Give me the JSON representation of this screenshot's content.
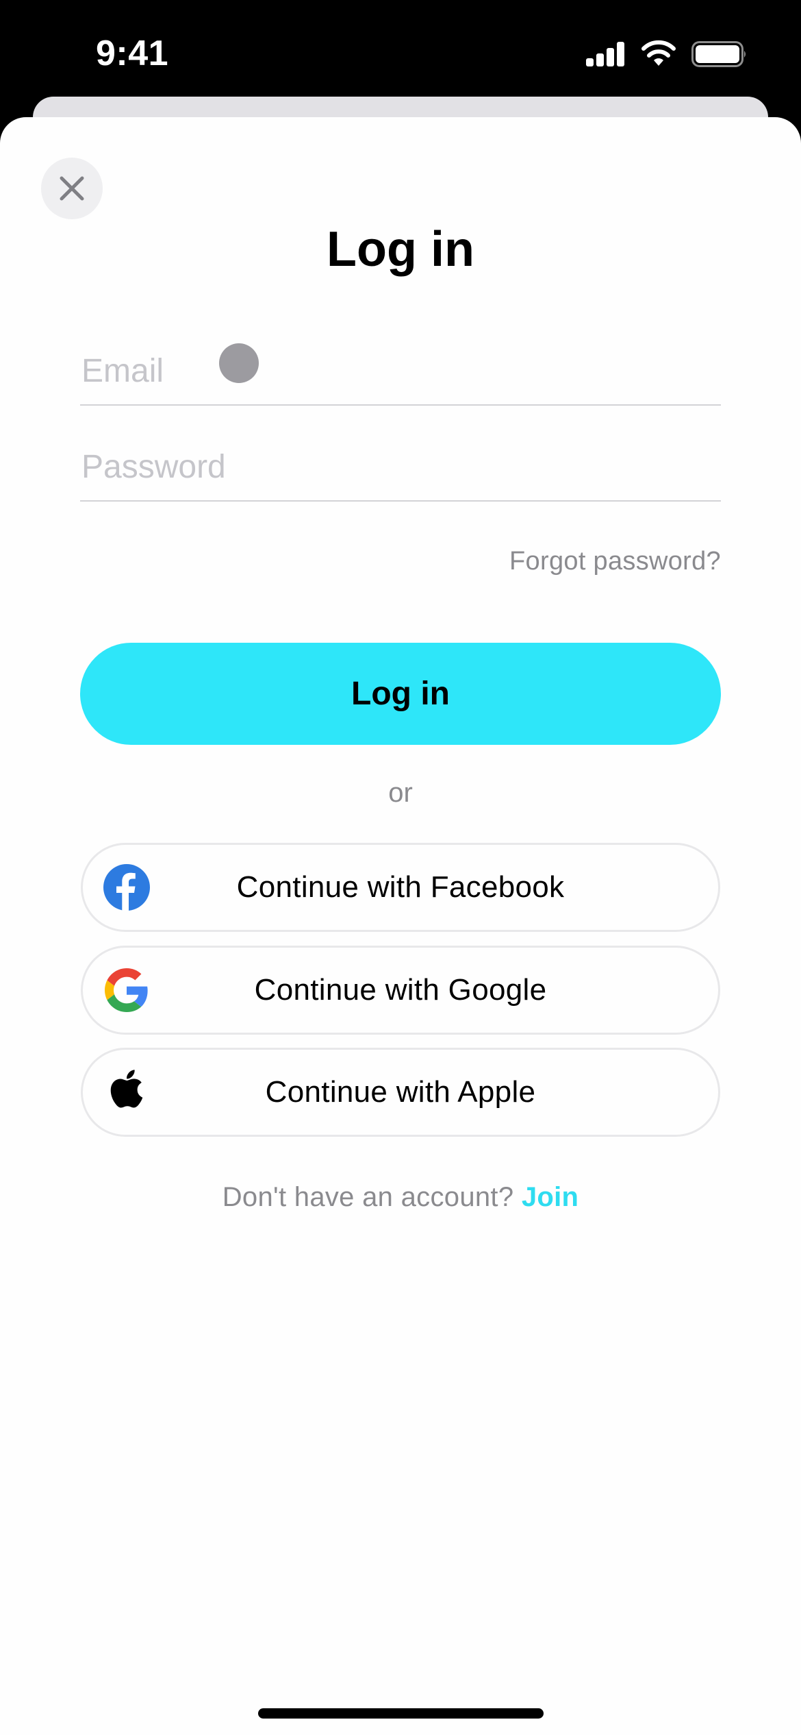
{
  "status_bar": {
    "time": "9:41",
    "icons": [
      "cellular-signal-icon",
      "wifi-icon",
      "battery-icon"
    ]
  },
  "sheet": {
    "close_icon": "close-icon",
    "title": "Log in"
  },
  "form": {
    "email": {
      "placeholder": "Email",
      "value": ""
    },
    "password": {
      "placeholder": "Password",
      "value": ""
    },
    "forgot_password": "Forgot password?",
    "login_button": "Log in",
    "or_divider": "or"
  },
  "social": [
    {
      "label": "Continue with Facebook",
      "icon": "facebook-icon"
    },
    {
      "label": "Continue with Google",
      "icon": "google-icon"
    },
    {
      "label": "Continue with Apple",
      "icon": "apple-icon"
    }
  ],
  "footer": {
    "prompt": "Don't have an account?",
    "join_link": "Join"
  },
  "colors": {
    "accent": "#2EE6F9",
    "link": "#2EDCF0",
    "secondary_text": "#8A8A8E",
    "placeholder": "#C5C5CA",
    "facebook": "#2D7BE0"
  }
}
